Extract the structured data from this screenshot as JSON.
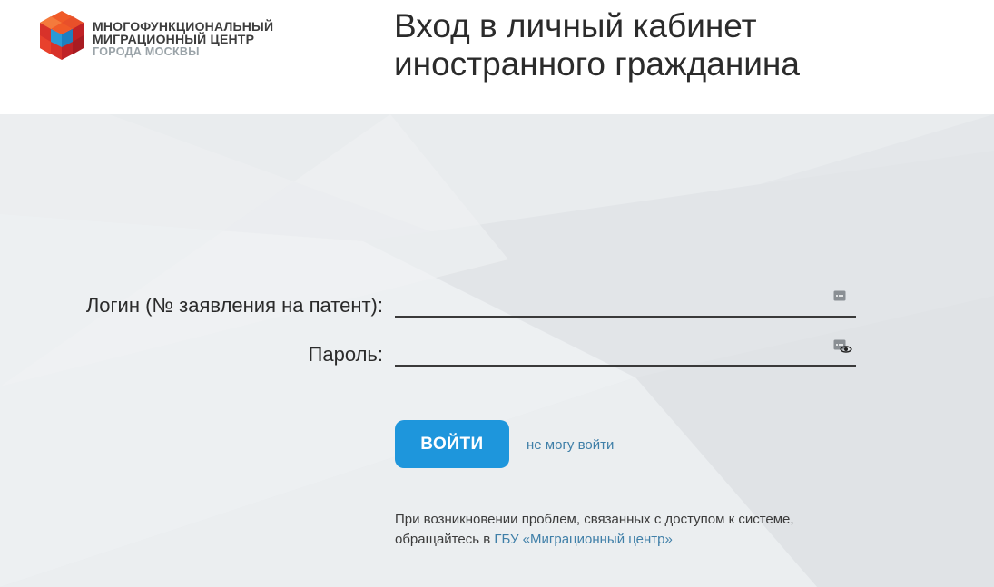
{
  "header": {
    "logo": {
      "line1": "МНОГОФУНКЦИОНАЛЬНЫЙ",
      "line2": "МИГРАЦИОННЫЙ ЦЕНТР",
      "line3": "ГОРОДА МОСКВЫ"
    },
    "title": "Вход в личный кабинет иностранного гражданина"
  },
  "form": {
    "login_label": "Логин (№ заявления на патент):",
    "login_value": "",
    "password_label": "Пароль:",
    "password_value": "",
    "submit_label": "ВОЙТИ",
    "help_link": "не могу войти"
  },
  "info": {
    "text_line1": "При возникновении проблем, связанных с доступом к системе,",
    "text_line2_prefix": "обращайтесь в ",
    "link": "ГБУ «Миграционный центр»"
  },
  "colors": {
    "accent": "#1e96dc",
    "link": "#3f7fa8",
    "logo_red": "#e8412c",
    "logo_dark_red": "#b71e1e",
    "logo_blue": "#1e7fc0",
    "background": "#e6e9eb"
  }
}
